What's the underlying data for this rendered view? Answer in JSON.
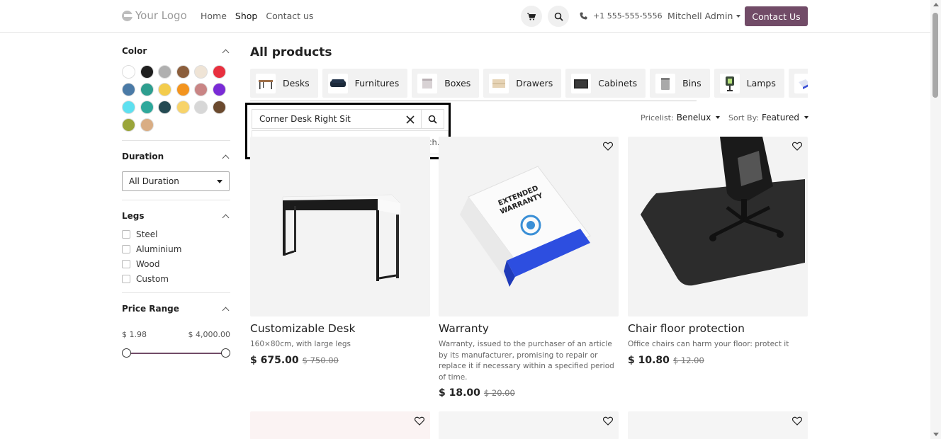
{
  "header": {
    "logo": "Your Logo",
    "nav": [
      {
        "label": "Home",
        "active": false
      },
      {
        "label": "Shop",
        "active": true
      },
      {
        "label": "Contact us",
        "active": false
      }
    ],
    "phone": "+1 555-555-5556",
    "user": "Mitchell Admin",
    "contact_button": "Contact Us",
    "accent_color": "#714b67"
  },
  "sidebar": {
    "color": {
      "title": "Color",
      "swatches": [
        "#ffffff",
        "#1f1f1f",
        "#b0b0b0",
        "#8b5e3c",
        "#efe4d6",
        "#e8303f",
        "#4a7aa6",
        "#2e9e8f",
        "#f3cc4c",
        "#f3941e",
        "#c98585",
        "#7a2bd6",
        "#5ee0f0",
        "#2ea89b",
        "#244a52",
        "#f7d36a",
        "#d7d7d7",
        "#6b4a2e",
        "#9aa53a",
        "#d9ad84"
      ]
    },
    "duration": {
      "title": "Duration",
      "selected": "All Duration"
    },
    "legs": {
      "title": "Legs",
      "options": [
        "Steel",
        "Aluminium",
        "Wood",
        "Custom"
      ]
    },
    "price_range": {
      "title": "Price Range",
      "min": "$ 1.98",
      "max": "$ 4,000.00"
    }
  },
  "main": {
    "title": "All products",
    "categories": [
      "Desks",
      "Furnitures",
      "Boxes",
      "Drawers",
      "Cabinets",
      "Bins",
      "Lamps",
      ""
    ],
    "search": {
      "value": "Corner Desk Right Sit",
      "no_results": "No results found. Please try another search."
    },
    "pricelist": {
      "label": "Pricelist:",
      "value": "Benelux"
    },
    "sort": {
      "label": "Sort By:",
      "value": "Featured"
    },
    "products": [
      {
        "name": "Customizable Desk",
        "desc": "160×80cm, with large legs",
        "price": "$ 675.00",
        "old_price": "$ 750.00"
      },
      {
        "name": "Warranty",
        "desc": "Warranty, issued to the purchaser of an article by its manufacturer, promising to repair or replace it if necessary within a specified period of time.",
        "price": "$ 18.00",
        "old_price": "$ 20.00"
      },
      {
        "name": "Chair floor protection",
        "desc": "Office chairs can harm your floor: protect it",
        "price": "$ 10.80",
        "old_price": "$ 12.00"
      }
    ],
    "warranty_box_text": "EXTENDED WARRANTY"
  }
}
